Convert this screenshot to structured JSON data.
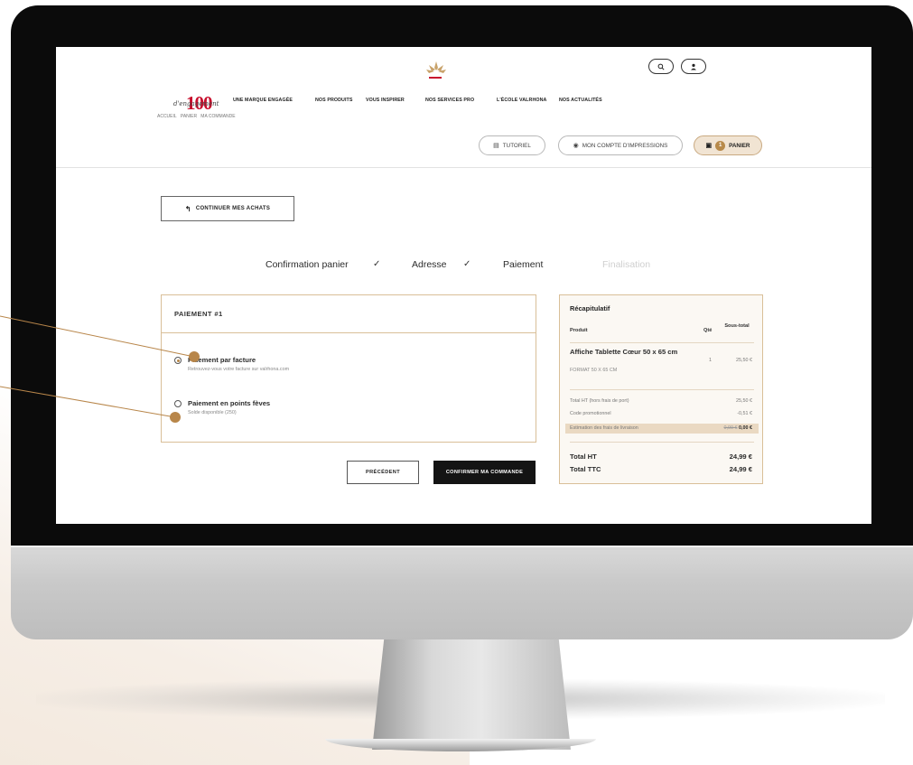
{
  "header": {
    "nav": [
      "UNE MARQUE ENGAGÉE",
      "NOS PRODUITS",
      "VOUS INSPIRER",
      "NOS SERVICES PRO",
      "L'ÉCOLE VALRHONA",
      "NOS ACTUALITÉS"
    ],
    "breadcrumb": [
      "ACCUEIL",
      "PANIER",
      "MA COMMANDE"
    ],
    "logo_number": "100",
    "logo_script": "d'engagement",
    "pills": {
      "tutorial": "TUTORIEL",
      "account": "MON COMPTE D'IMPRESSIONS",
      "cart": "PANIER",
      "cart_count": "1"
    }
  },
  "continue_label": "CONTINUER MES ACHATS",
  "steps": [
    {
      "label": "Confirmation panier",
      "state": "done"
    },
    {
      "label": "Adresse",
      "state": "done"
    },
    {
      "label": "Paiement",
      "state": "current"
    },
    {
      "label": "Finalisation",
      "state": "future"
    }
  ],
  "payment": {
    "title": "PAIEMENT #1",
    "options": [
      {
        "title": "Paiement par facture",
        "subtitle": "Retrouvez-vous votre facture sur valrhona.com",
        "selected": true
      },
      {
        "title": "Paiement en points fèves",
        "subtitle": "Solde disponible (250)",
        "selected": false
      }
    ],
    "previous_label": "PRÉCÉDENT",
    "confirm_label": "CONFIRMER MA COMMANDE"
  },
  "summary": {
    "title": "Récapitulatif",
    "col_product": "Produit",
    "col_qty": "Qté",
    "col_subtotal": "Sous-total",
    "product_name": "Affiche Tablette Cœur 50 x 65 cm",
    "product_format": "FORMAT 50 X 65 CM",
    "product_qty": "1",
    "product_subtotal": "25,50 €",
    "lines": {
      "total_ht_label": "Total HT (hors frais de port)",
      "total_ht_value": "25,50 €",
      "promo_label": "Code promotionnel",
      "promo_value": "-0,51 €",
      "shipping_label": "Estimation des frais de livraison",
      "shipping_old": "0,00 €",
      "shipping_value": "0,00 €"
    },
    "total_ht_label": "Total HT",
    "total_ht": "24,99 €",
    "total_ttc_label": "Total TTC",
    "total_ttc": "24,99 €"
  },
  "colors": {
    "accent": "#b8864a",
    "brand_red": "#c8102e",
    "border": "#d9bf98"
  }
}
